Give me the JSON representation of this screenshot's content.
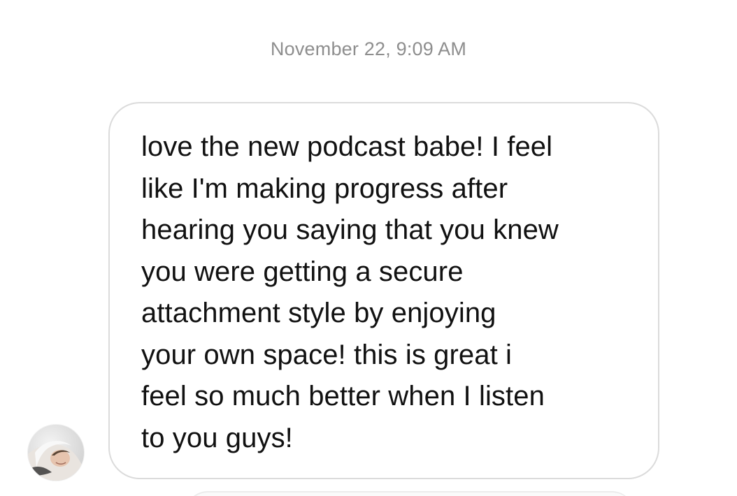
{
  "thread": {
    "timestamp": "November 22, 9:09 AM"
  },
  "message": {
    "text": "love the new podcast babe! I feel\nlike I'm making progress after\nhearing you saying that you knew\nyou were getting a secure\nattachment style by enjoying\nyour own space! this is great i\nfeel so much better when I listen\nto you guys!",
    "bubble_border_color": "#dbdbdb",
    "text_color": "#111111"
  },
  "sender": {
    "avatar_icon": "user-avatar-photo"
  },
  "colors": {
    "background": "#ffffff",
    "timestamp": "#8e8e8e"
  }
}
